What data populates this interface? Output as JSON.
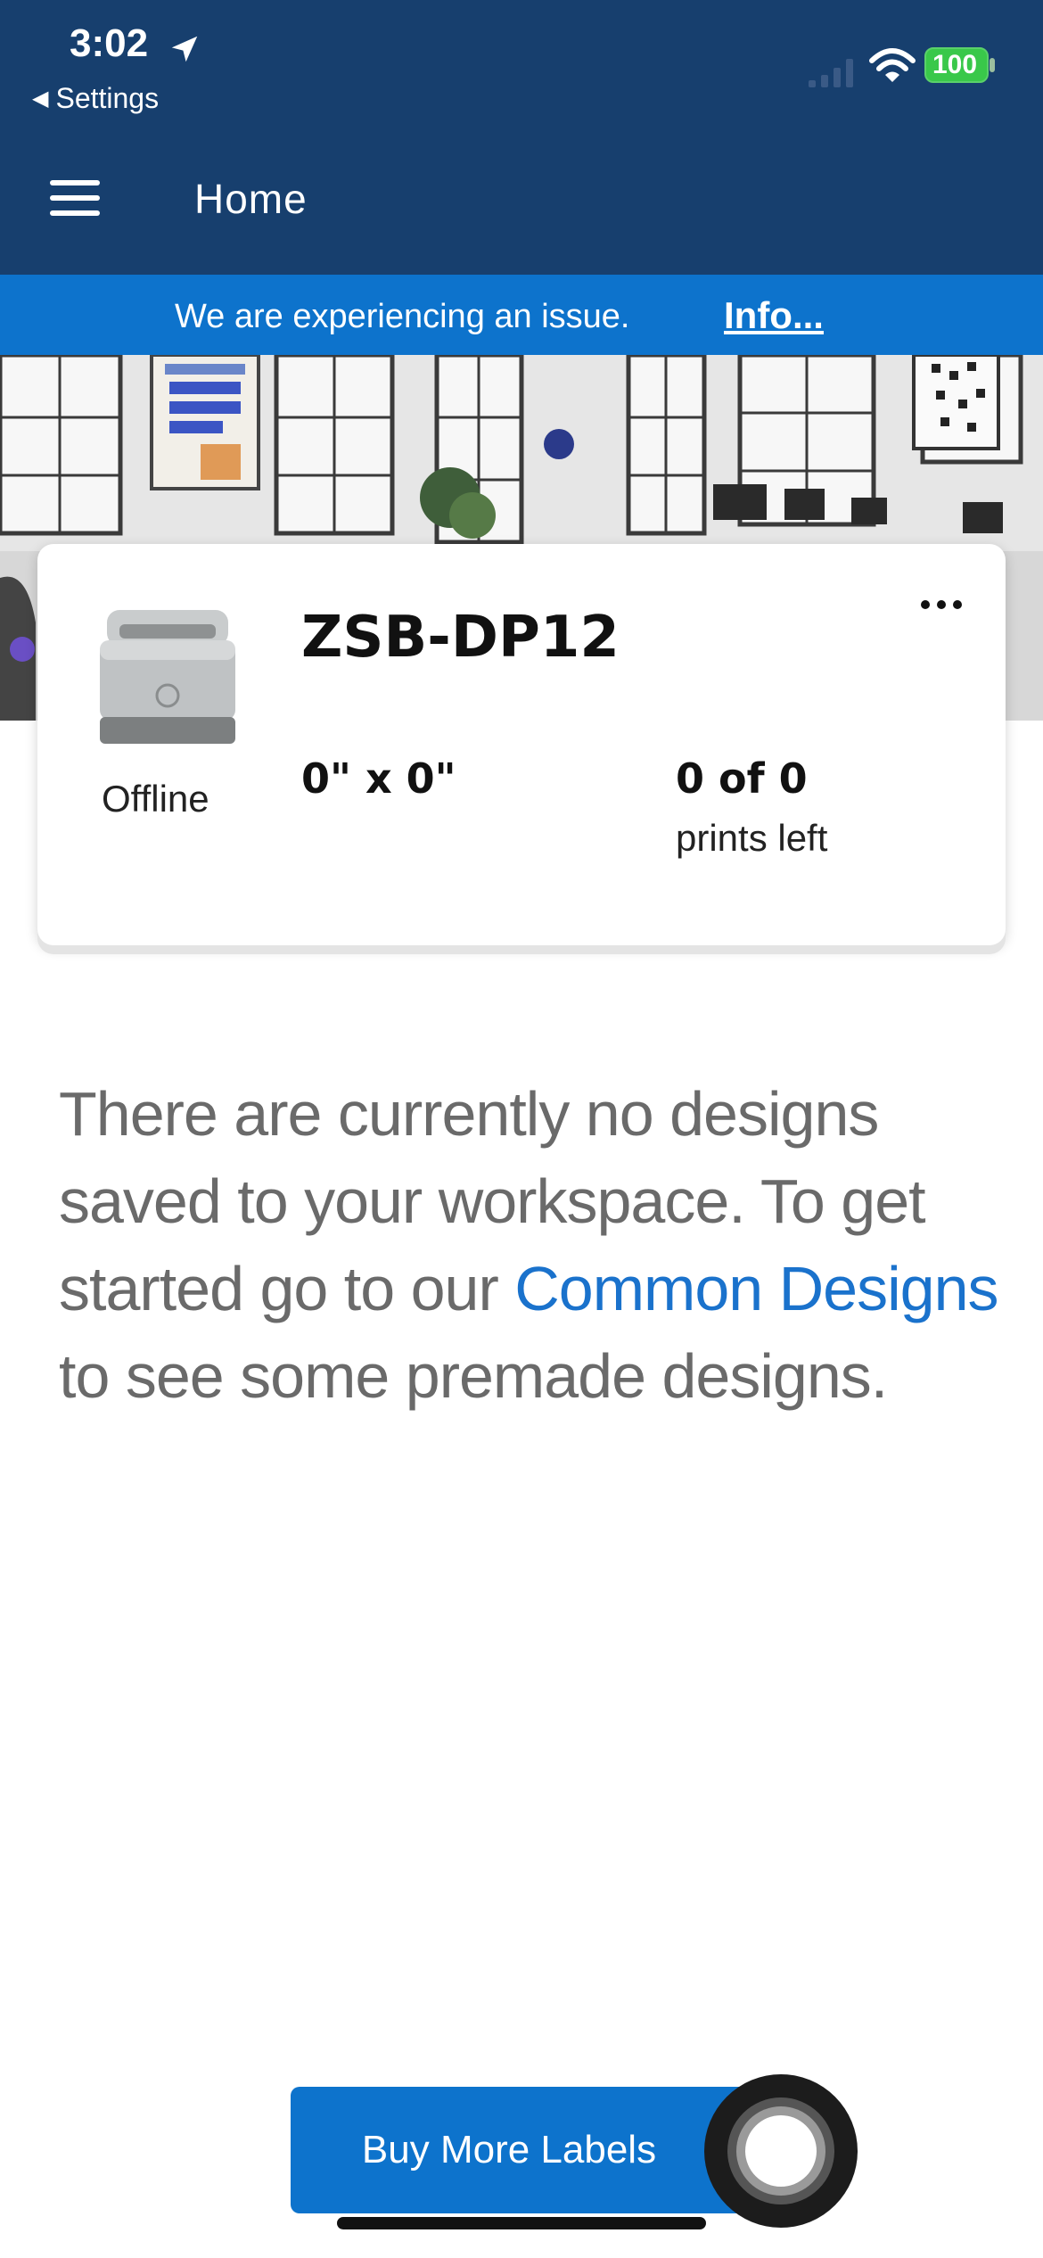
{
  "status_bar": {
    "time": "3:02",
    "back_label": "Settings",
    "battery": "100"
  },
  "header": {
    "title": "Home",
    "menu_icon": "hamburger-menu-icon"
  },
  "banner": {
    "message": "We are experiencing an issue.",
    "link_label": "Info..."
  },
  "printer_card": {
    "name": "ZSB-DP12",
    "status": "Offline",
    "label_size": "0\" x 0\"",
    "prints_count": "0 of 0",
    "prints_caption": "prints left",
    "more_icon": "more-horizontal-icon"
  },
  "empty_state": {
    "text_before": "There are currently no designs saved to your workspace. To get started go to our ",
    "link_text": "Common Designs",
    "text_after": " to see some premade designs."
  },
  "footer": {
    "buy_button_label": "Buy More Labels"
  },
  "colors": {
    "header": "#173f6e",
    "banner": "#0d73cc",
    "link": "#1a72cc",
    "button": "#0d73cc"
  }
}
